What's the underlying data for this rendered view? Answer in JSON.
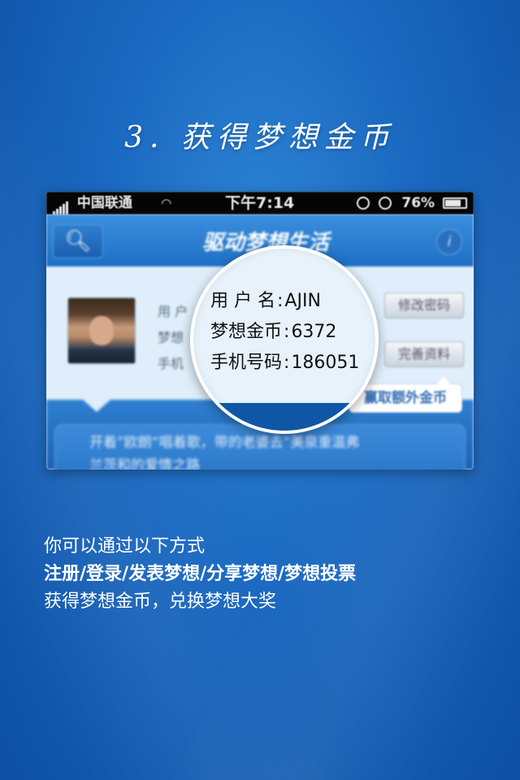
{
  "step_title": "3. 获得梦想金币",
  "status_bar": {
    "carrier": "中国联通",
    "time": "下午7:14",
    "battery": "76%"
  },
  "app": {
    "title": "驱动梦想生活",
    "profile_labels": [
      "用 户",
      "梦想",
      "手机"
    ],
    "buttons": {
      "change_password": "修改密码",
      "complete_profile": "完善资料"
    },
    "tip": "赢取额外金币",
    "news_line1": "开着”欧朗“唱着歌，带的老婆去”美泉重温弗",
    "news_line2": "兰茨和的爱情之路"
  },
  "magnifier": {
    "username_label": "用 户 名",
    "username": "AJIN",
    "coins_label": "梦想金币",
    "coins": "6372",
    "phone_label": "手机号码",
    "phone": "186051",
    "separator": ":"
  },
  "description": {
    "line1": "你可以通过以下方式",
    "line2": "注册/登录/发表梦想/分享梦想/梦想投票",
    "line3": "获得梦想金币，兑换梦想大奖"
  },
  "colors": {
    "background": "#1a68c0",
    "nav_blue": "#2a78c8",
    "accent_text": "#3870b4"
  }
}
